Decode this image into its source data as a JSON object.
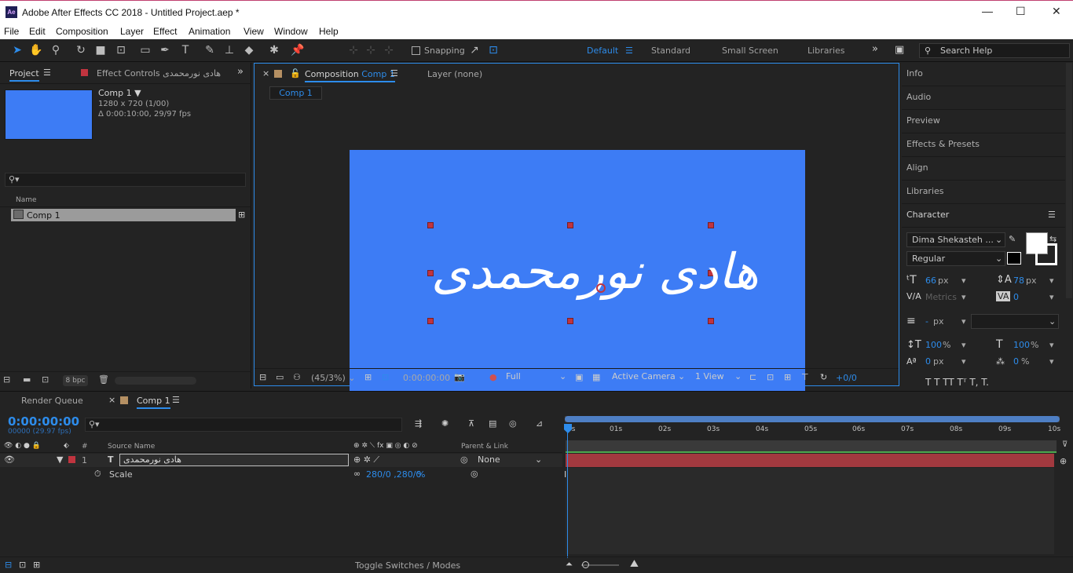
{
  "window": {
    "title": "Adobe After Effects CC 2018 - Untitled Project.aep *",
    "logo": "Ae",
    "controls": [
      "—",
      "☐",
      "✕"
    ]
  },
  "menu": [
    "File",
    "Edit",
    "Composition",
    "Layer",
    "Effect",
    "Animation",
    "View",
    "Window",
    "Help"
  ],
  "toolbar": {
    "snapping_label": "Snapping",
    "workspaces": [
      "Default",
      "Standard",
      "Small Screen",
      "Libraries"
    ],
    "active_workspace": "Default",
    "search_placeholder": "Search Help"
  },
  "project_panel": {
    "tab_project": "Project",
    "tab_effect_controls": "Effect Controls هادی نورمحمدی",
    "comp_name": "Comp 1 ▼",
    "comp_size": "1280 x 720 (1/00)",
    "comp_duration": "Δ 0:00:10:00, 29/97 fps",
    "column_name": "Name",
    "item": "Comp 1",
    "bpc": "8 bpc"
  },
  "composition_panel": {
    "tab_label": "Composition",
    "tab_comp": "Comp 1",
    "layer_tab": "Layer (none)",
    "breadcrumb": "Comp 1",
    "text_layer": "هادی نورمحمدی",
    "zoom": "(45/3%)",
    "timecode": "0:00:00:00",
    "resolution": "Full",
    "camera": "Active Camera",
    "views": "1 View",
    "exposure": "+0/0"
  },
  "right_panel": {
    "items": [
      "Info",
      "Audio",
      "Preview",
      "Effects & Presets",
      "Align",
      "Libraries",
      "Character"
    ],
    "font_family": "Dima Shekasteh ...",
    "font_style": "Regular",
    "font_size": "66",
    "font_size_unit": "px",
    "leading": "78",
    "leading_unit": "px",
    "kerning": "Metrics",
    "tracking": "0",
    "stroke_width": "-",
    "stroke_unit": "px",
    "vert_scale": "100",
    "vert_scale_unit": "%",
    "horiz_scale": "100",
    "horiz_scale_unit": "%",
    "baseline": "0",
    "baseline_unit": "px",
    "tsume": "0",
    "tsume_unit": "%"
  },
  "timeline": {
    "tab_render_queue": "Render Queue",
    "tab_comp": "Comp 1",
    "timecode": "0:00:00:00",
    "frames": "00000 (29.97 fps)",
    "col_number": "#",
    "col_source_name": "Source Name",
    "col_parent": "Parent & Link",
    "layer_number": "1",
    "layer_name": "هادی نورمحمدی",
    "layer_type_icon": "T",
    "parent_value": "None",
    "property_name": "Scale",
    "property_value": "280/0 ,280/0",
    "property_unit": "%",
    "ruler": [
      "0s",
      "01s",
      "02s",
      "03s",
      "04s",
      "05s",
      "06s",
      "07s",
      "08s",
      "09s",
      "10s"
    ],
    "toggle_label": "Toggle Switches / Modes"
  },
  "colors": {
    "accent": "#2d8ceb",
    "canvas": "#3d7cf5",
    "layer_bar": "#a2393f",
    "handle": "#c0343f"
  }
}
